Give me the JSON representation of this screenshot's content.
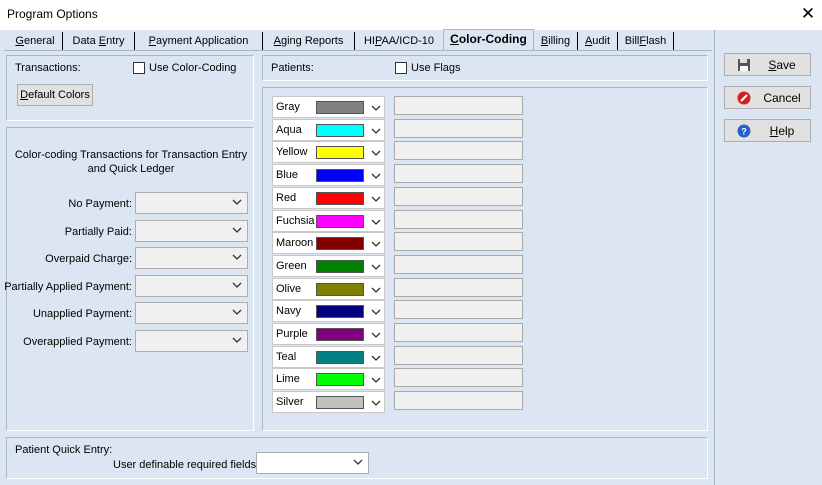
{
  "window": {
    "title": "Program Options"
  },
  "tabs": [
    {
      "pre": "",
      "ul": "G",
      "post": "eneral"
    },
    {
      "pre": "Data ",
      "ul": "E",
      "post": "ntry"
    },
    {
      "pre": "",
      "ul": "P",
      "post": "ayment Application"
    },
    {
      "pre": "",
      "ul": "A",
      "post": "ging Reports"
    },
    {
      "pre": "HI",
      "ul": "P",
      "post": "AA/ICD-10"
    },
    {
      "pre": "",
      "ul": "C",
      "post": "olor-Coding"
    },
    {
      "pre": "",
      "ul": "B",
      "post": "illing"
    },
    {
      "pre": "",
      "ul": "A",
      "post": "udit"
    },
    {
      "pre": "Bill",
      "ul": "F",
      "post": "lash"
    }
  ],
  "transactions": {
    "label": "Transactions:",
    "use_color_coding": "Use Color-Coding",
    "default_colors": "Default Colors",
    "heading": "Color-coding Transactions for Transaction Entry and Quick Ledger",
    "fields": [
      {
        "label": "No Payment:",
        "value": ""
      },
      {
        "label": "Partially Paid:",
        "value": ""
      },
      {
        "label": "Overpaid Charge:",
        "value": ""
      },
      {
        "label": "Partially Applied Payment:",
        "value": ""
      },
      {
        "label": "Unapplied Payment:",
        "value": ""
      },
      {
        "label": "Overapplied Payment:",
        "value": ""
      }
    ]
  },
  "patients": {
    "label": "Patients:",
    "use_flags": "Use Flags",
    "colors": [
      {
        "name": "Gray",
        "hex": "#808080",
        "flag": ""
      },
      {
        "name": "Aqua",
        "hex": "#00ffff",
        "flag": ""
      },
      {
        "name": "Yellow",
        "hex": "#ffff00",
        "flag": ""
      },
      {
        "name": "Blue",
        "hex": "#0000ff",
        "flag": ""
      },
      {
        "name": "Red",
        "hex": "#ff0000",
        "flag": ""
      },
      {
        "name": "Fuchsia",
        "hex": "#ff00ff",
        "flag": ""
      },
      {
        "name": "Maroon",
        "hex": "#800000",
        "flag": ""
      },
      {
        "name": "Green",
        "hex": "#008000",
        "flag": ""
      },
      {
        "name": "Olive",
        "hex": "#808000",
        "flag": ""
      },
      {
        "name": "Navy",
        "hex": "#000080",
        "flag": ""
      },
      {
        "name": "Purple",
        "hex": "#800080",
        "flag": ""
      },
      {
        "name": "Teal",
        "hex": "#008080",
        "flag": ""
      },
      {
        "name": "Lime",
        "hex": "#00ff00",
        "flag": ""
      },
      {
        "name": "Silver",
        "hex": "#c0c0c0",
        "flag": ""
      }
    ]
  },
  "quick_entry": {
    "label": "Patient Quick Entry:",
    "required_label": "User definable required fields:",
    "value": ""
  },
  "buttons": {
    "save": {
      "ul": "S",
      "post": "ave"
    },
    "cancel": {
      "label": "Cancel"
    },
    "help": {
      "ul": "H",
      "post": "elp"
    }
  }
}
